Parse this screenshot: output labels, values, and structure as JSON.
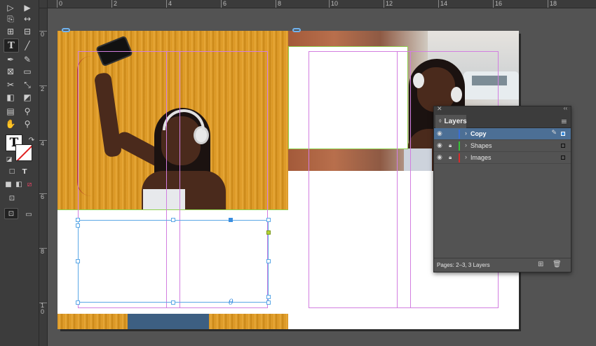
{
  "ruler": {
    "top_ticks": [
      "0",
      "2",
      "4",
      "6",
      "8",
      "10",
      "12",
      "14",
      "16",
      "18"
    ],
    "left_ticks": [
      "0",
      "2",
      "4",
      "6",
      "8",
      "1\n0"
    ]
  },
  "tools": [
    {
      "name": "selection-tool-icon",
      "glyph": "▷"
    },
    {
      "name": "direct-selection-tool-icon",
      "glyph": "▶"
    },
    {
      "name": "page-tool-icon",
      "glyph": "⎘"
    },
    {
      "name": "gap-tool-icon",
      "glyph": "↔"
    },
    {
      "name": "content-collector-icon",
      "glyph": "⊞"
    },
    {
      "name": "content-placer-icon",
      "glyph": "⊟"
    },
    {
      "name": "type-tool-icon",
      "glyph": "T"
    },
    {
      "name": "line-tool-icon",
      "glyph": "╱"
    },
    {
      "name": "pen-tool-icon",
      "glyph": "✒"
    },
    {
      "name": "pencil-tool-icon",
      "glyph": "✎"
    },
    {
      "name": "rectangle-frame-tool-icon",
      "glyph": "⊠"
    },
    {
      "name": "rectangle-tool-icon",
      "glyph": "▭"
    },
    {
      "name": "scissors-tool-icon",
      "glyph": "✂"
    },
    {
      "name": "free-transform-tool-icon",
      "glyph": "⤡"
    },
    {
      "name": "gradient-swatch-tool-icon",
      "glyph": "◧"
    },
    {
      "name": "gradient-feather-tool-icon",
      "glyph": "◩"
    },
    {
      "name": "note-tool-icon",
      "glyph": "▤"
    },
    {
      "name": "eyedropper-tool-icon",
      "glyph": "⚲"
    },
    {
      "name": "hand-tool-icon",
      "glyph": "✋"
    },
    {
      "name": "zoom-tool-icon",
      "glyph": "⚲"
    }
  ],
  "layers_panel": {
    "tab_label": "Layers",
    "layers": [
      {
        "name": "Copy",
        "color": "#3a6fd8",
        "selected": true,
        "locked": false
      },
      {
        "name": "Shapes",
        "color": "#38c338",
        "selected": false,
        "locked": true
      },
      {
        "name": "Images",
        "color": "#d82b2b",
        "selected": false,
        "locked": true
      }
    ],
    "footer_text": "Pages: 2–3, 3 Layers"
  },
  "colors": {
    "accent_blue": "#4c6f95",
    "guide_magenta": "#d27ee0",
    "frame_blue": "#5aa7e6",
    "layer_copy": "#3a6fd8",
    "layer_shapes": "#38c338",
    "layer_images": "#d82b2b"
  }
}
